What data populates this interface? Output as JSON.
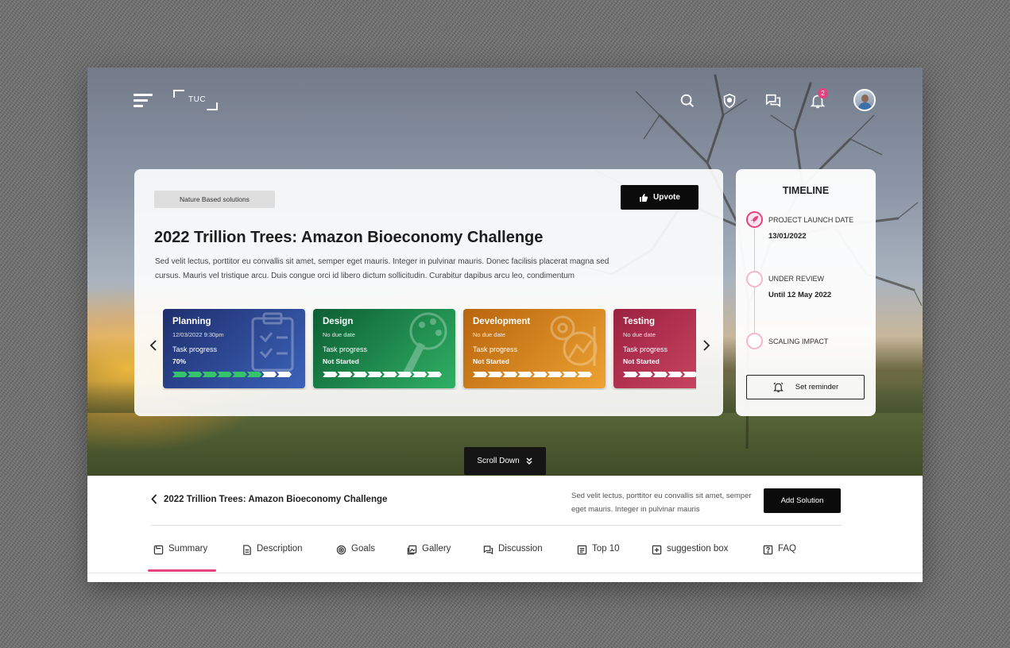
{
  "header": {
    "logo_text": "TUC",
    "notification_count": "2"
  },
  "hero": {
    "tag": "Nature Based solutions",
    "upvote_label": "Upvote",
    "title": "2022 Trillion Trees: Amazon Bioeconomy Challenge",
    "description": "Sed velit lectus, porttitor eu convallis sit amet, semper eget mauris. Integer in pulvinar mauris. Donec facilisis placerat magna sed cursus. Mauris vel tristique arcu. Duis congue orci id libero dictum sollicitudin. Curabitur dapibus arcu leo, condimentum",
    "scroll_label": "Scroll Down"
  },
  "stages": [
    {
      "title": "Planning",
      "date": "12/03/2022  9:30pm",
      "progress_label": "Task progress",
      "progress_value": "70%",
      "progress_fraction": 0.7,
      "colors": [
        "#1f2f6e",
        "#3b62b8"
      ],
      "icon": "clipboard-icon"
    },
    {
      "title": "Design",
      "date": "No due date",
      "progress_label": "Task progress",
      "progress_value": "Not Started",
      "progress_fraction": 0,
      "colors": [
        "#0d5e34",
        "#2fb064"
      ],
      "icon": "palette-icon"
    },
    {
      "title": "Development",
      "date": "No due date",
      "progress_label": "Task progress",
      "progress_value": "Not Started",
      "progress_fraction": 0,
      "colors": [
        "#b9650d",
        "#eda232"
      ],
      "icon": "gear-chart-icon"
    },
    {
      "title": "Testing",
      "date": "No due date",
      "progress_label": "Task progress",
      "progress_value": "Not Started",
      "progress_fraction": 0,
      "colors": [
        "#9c2140",
        "#d6506c"
      ],
      "icon": "test-icon"
    }
  ],
  "timeline": {
    "title": "TIMELINE",
    "items": [
      {
        "label": "PROJECT LAUNCH DATE",
        "value": "13/01/2022"
      },
      {
        "label": "UNDER REVIEW",
        "value": "Until 12 May 2022"
      },
      {
        "label": "SCALING IMPACT",
        "value": ""
      }
    ],
    "reminder_label": "Set reminder"
  },
  "section": {
    "back_title": "2022 Trillion Trees: Amazon Bioeconomy Challenge",
    "side_text": "Sed velit lectus, porttitor eu convallis sit amet, semper eget mauris. Integer in pulvinar mauris",
    "add_solution_label": "Add Solution"
  },
  "tabs": [
    {
      "label": "Summary",
      "icon": "summary-icon",
      "active": true
    },
    {
      "label": "Description",
      "icon": "document-icon",
      "active": false
    },
    {
      "label": "Goals",
      "icon": "target-icon",
      "active": false
    },
    {
      "label": "Gallery",
      "icon": "gallery-icon",
      "active": false
    },
    {
      "label": "Discussion",
      "icon": "chat-icon",
      "active": false
    },
    {
      "label": "Top 10",
      "icon": "list-icon",
      "active": false
    },
    {
      "label": "suggestion box",
      "icon": "plus-box-icon",
      "active": false
    },
    {
      "label": "FAQ",
      "icon": "question-icon",
      "active": false
    }
  ],
  "colors": {
    "accent": "#e8417f",
    "dark_button": "#0b0b0b"
  }
}
